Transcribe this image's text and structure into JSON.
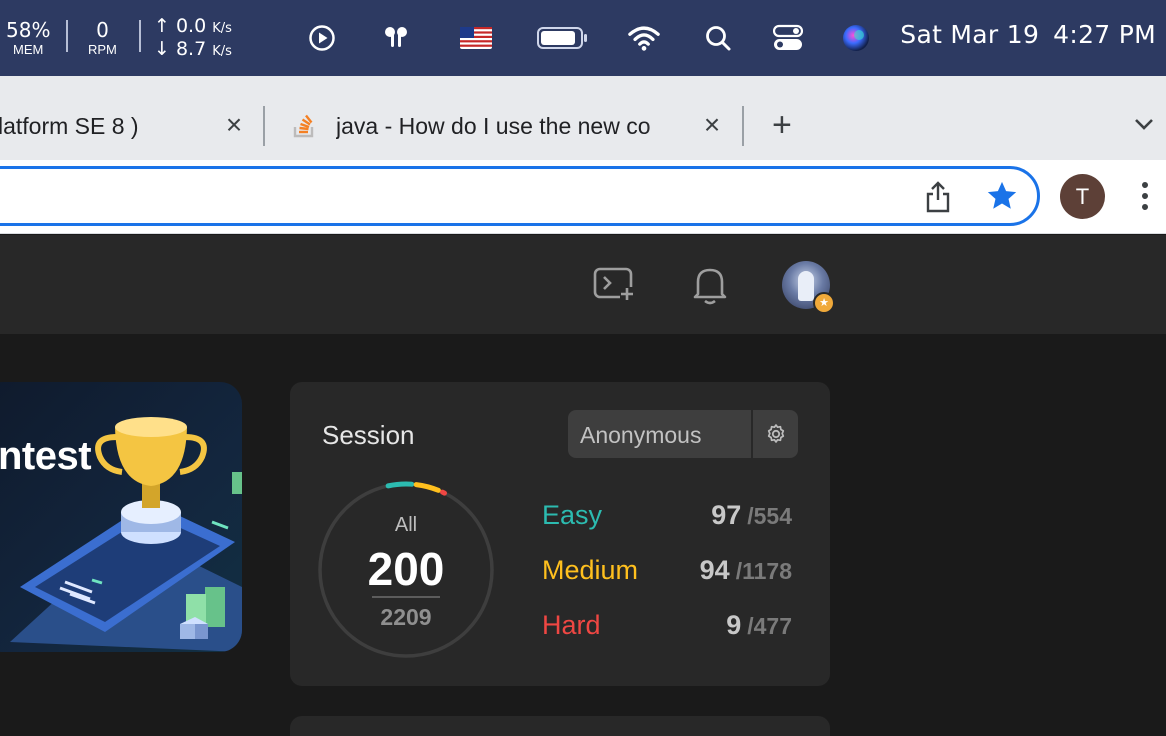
{
  "menubar": {
    "mem_value": "58%",
    "mem_label": "MEM",
    "rpm_value": "0",
    "rpm_label": "RPM",
    "net_up": "0.0",
    "net_down": "8.7",
    "net_unit": "K/s",
    "date": "Sat Mar 19",
    "time": "4:27 PM",
    "icons": [
      "play-icon",
      "airpods-icon",
      "us-flag-icon",
      "battery-icon",
      "wifi-icon",
      "search-icon",
      "control-center-icon",
      "siri-icon"
    ]
  },
  "tabs": [
    {
      "title": "latform SE 8 )",
      "active": false
    },
    {
      "title": "java - How do I use the new co",
      "active": true,
      "favicon": "stackoverflow-icon"
    }
  ],
  "toolbar": {
    "profile_initial": "T"
  },
  "banner": {
    "title": "ntest"
  },
  "session": {
    "title": "Session",
    "selected": "Anonymous",
    "all_label": "All",
    "solved": "200",
    "total": "2209",
    "difficulties": [
      {
        "label": "Easy",
        "solved": "97",
        "total": "/554",
        "color": "#2cbbb0"
      },
      {
        "label": "Medium",
        "solved": "94",
        "total": "/1178",
        "color": "#ffc01e"
      },
      {
        "label": "Hard",
        "solved": "9",
        "total": "/477",
        "color": "#ef4743"
      }
    ]
  },
  "colors": {
    "accent": "#1a73e8",
    "easy": "#2cbbb0",
    "medium": "#ffc01e",
    "hard": "#ef4743",
    "nav_bg": "#282828",
    "card_bg": "#282828"
  }
}
